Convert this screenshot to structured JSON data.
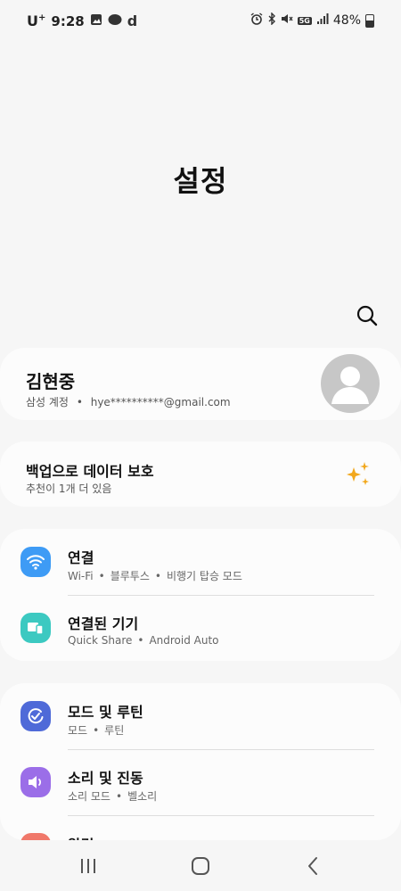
{
  "status_bar": {
    "carrier": "U",
    "carrier_sup": "+",
    "time": "9:28",
    "network_badge": "5G",
    "battery": "48%"
  },
  "header": {
    "title": "설정"
  },
  "profile": {
    "name": "김현중",
    "account_label": "삼성 계정",
    "email": "hye**********@gmail.com"
  },
  "backup": {
    "title": "백업으로 데이터 보호",
    "subtitle": "추천이 1개 더 있음"
  },
  "settings_groups": [
    {
      "items": [
        {
          "label": "연결",
          "sub": [
            "Wi-Fi",
            "블루투스",
            "비행기 탑승 모드"
          ],
          "icon": "wifi-icon",
          "color": "#3e9bf5"
        },
        {
          "label": "연결된 기기",
          "sub": [
            "Quick Share",
            "Android Auto"
          ],
          "icon": "connected-devices-icon",
          "color": "#3cc9c1"
        }
      ]
    },
    {
      "items": [
        {
          "label": "모드 및 루틴",
          "sub": [
            "모드",
            "루틴"
          ],
          "icon": "modes-routines-icon",
          "color": "#4f6ad8"
        },
        {
          "label": "소리 및 진동",
          "sub": [
            "소리 모드",
            "벨소리"
          ],
          "icon": "sound-icon",
          "color": "#9b6ee8"
        },
        {
          "label": "알림",
          "sub": [],
          "icon": "notifications-icon",
          "color": "#f0786a"
        }
      ]
    }
  ],
  "sparkle_color": "#f2a81d"
}
